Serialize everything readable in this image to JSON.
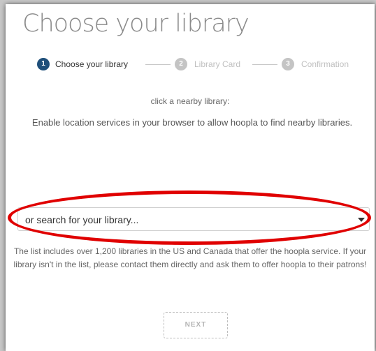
{
  "page": {
    "title": "Choose your library"
  },
  "stepper": {
    "steps": [
      {
        "number": "1",
        "label": "Choose your library",
        "state": "active"
      },
      {
        "number": "2",
        "label": "Library Card",
        "state": "inactive"
      },
      {
        "number": "3",
        "label": "Confirmation",
        "state": "inactive"
      }
    ]
  },
  "content": {
    "hint": "click a nearby library:",
    "location_message": "Enable location services in your browser to allow hoopla to find nearby libraries.",
    "library_select": {
      "placeholder": "or search for your library..."
    },
    "info": "The list includes over 1,200 libraries in the US and Canada that offer the hoopla service. If your library isn't in the list, please contact them directly and ask them to offer hoopla to their patrons!",
    "next_label": "NEXT"
  },
  "colors": {
    "active_step": "#1f4f7a",
    "inactive_step": "#c4c4c4",
    "highlight": "#e00000"
  }
}
